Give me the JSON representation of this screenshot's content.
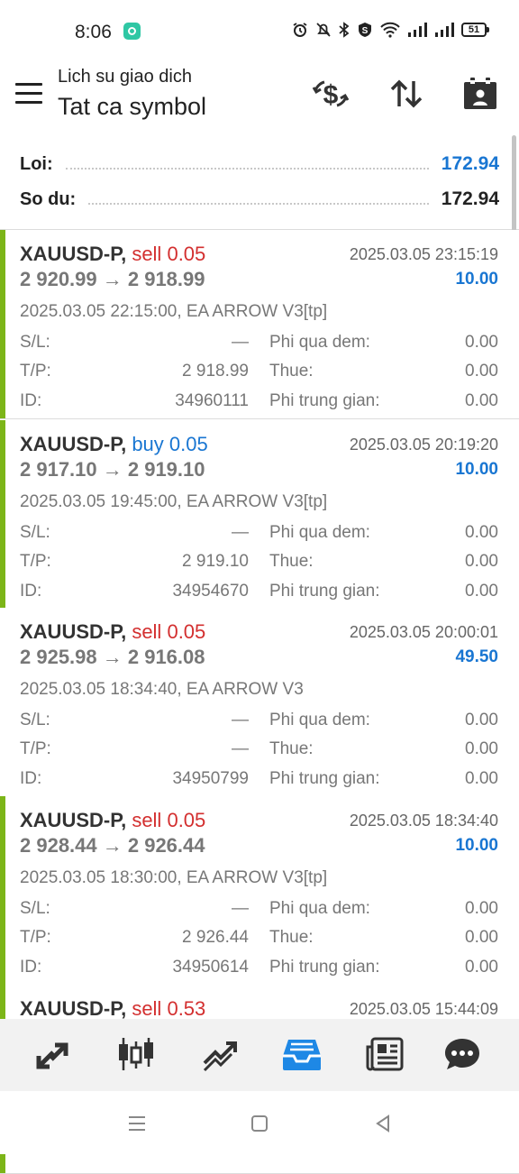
{
  "status_bar": {
    "time": "8:06",
    "battery": "51"
  },
  "header": {
    "subtitle": "Lich su giao dich",
    "title": "Tat ca symbol"
  },
  "summary": {
    "profit_label": "Loi:",
    "profit_value": "172.94",
    "balance_label": "So du:",
    "balance_value": "172.94"
  },
  "labels": {
    "sl": "S/L:",
    "tp": "T/P:",
    "id": "ID:",
    "swap": "Phi qua dem:",
    "tax": "Thue:",
    "commission": "Phi trung gian:"
  },
  "trades": [
    {
      "symbol": "XAUUSD-P,",
      "side": "sell",
      "volume": "0.05",
      "close_time": "2025.03.05 23:15:19",
      "prices": "2 920.99 → 2 918.99",
      "profit": "10.00",
      "open_info": "2025.03.05 22:15:00, EA ARROW V3[tp]",
      "sl": "—",
      "tp": "2 918.99",
      "id": "34960111",
      "swap": "0.00",
      "tax": "0.00",
      "commission": "0.00"
    },
    {
      "symbol": "XAUUSD-P,",
      "side": "buy",
      "volume": "0.05",
      "close_time": "2025.03.05 20:19:20",
      "prices": "2 917.10 → 2 919.10",
      "profit": "10.00",
      "open_info": "2025.03.05 19:45:00, EA ARROW V3[tp]",
      "sl": "—",
      "tp": "2 919.10",
      "id": "34954670",
      "swap": "0.00",
      "tax": "0.00",
      "commission": "0.00"
    },
    {
      "symbol": "XAUUSD-P,",
      "side": "sell",
      "volume": "0.05",
      "close_time": "2025.03.05 20:00:01",
      "prices": "2 925.98 → 2 916.08",
      "profit": "49.50",
      "open_info": "2025.03.05 18:34:40, EA ARROW V3",
      "sl": "—",
      "tp": "—",
      "id": "34950799",
      "swap": "0.00",
      "tax": "0.00",
      "commission": "0.00"
    },
    {
      "symbol": "XAUUSD-P,",
      "side": "sell",
      "volume": "0.05",
      "close_time": "2025.03.05 18:34:40",
      "prices": "2 928.44 → 2 926.44",
      "profit": "10.00",
      "open_info": "2025.03.05 18:30:00, EA ARROW V3[tp]",
      "sl": "—",
      "tp": "2 926.44",
      "id": "34950614",
      "swap": "0.00",
      "tax": "0.00",
      "commission": "0.00"
    },
    {
      "symbol": "XAUUSD-P,",
      "side": "sell",
      "volume": "0.53",
      "close_time": "2025.03.05 15:44:09"
    }
  ],
  "colors": {
    "sell": "#d32f2f",
    "buy": "#1976d2",
    "profit": "#1976d2",
    "win_bar": "#7cb518",
    "nav_active": "#1e88e5"
  },
  "bottom_nav": [
    {
      "icon": "trade-icon",
      "active": false
    },
    {
      "icon": "chart-candles-icon",
      "active": false
    },
    {
      "icon": "trend-icon",
      "active": false
    },
    {
      "icon": "history-inbox-icon",
      "active": true
    },
    {
      "icon": "news-icon",
      "active": false
    },
    {
      "icon": "chat-icon",
      "active": false
    }
  ]
}
